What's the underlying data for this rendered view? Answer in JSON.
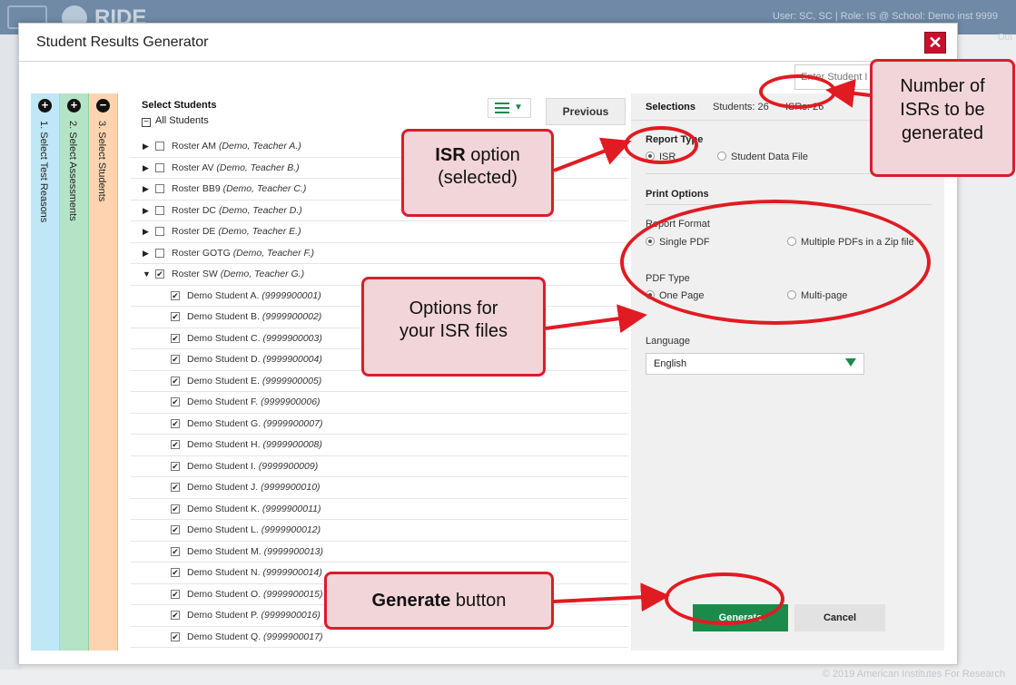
{
  "background": {
    "logo_text": "RIDE",
    "user_info": "User: SC, SC  |  Role: IS @ School: Demo inst 9999",
    "signout": "Out",
    "footer": "© 2019 American Institutes For Research"
  },
  "modal": {
    "title": "Student Results Generator",
    "close_icon": "close-icon",
    "search_placeholder": "Enter Student I"
  },
  "steps": [
    {
      "label": "1. Select Test Reasons",
      "icon": "plus"
    },
    {
      "label": "2. Select Assessments",
      "icon": "plus"
    },
    {
      "label": "3. Select Students",
      "icon": "minus"
    }
  ],
  "students_panel": {
    "title": "Select Students",
    "all_students": "All Students",
    "previous_button": "Previous",
    "rosters": [
      {
        "label": "Roster AM",
        "sub": "(Demo, Teacher A.)",
        "expanded": false,
        "checked": false
      },
      {
        "label": "Roster AV",
        "sub": "(Demo, Teacher B.)",
        "expanded": false,
        "checked": false
      },
      {
        "label": "Roster BB9",
        "sub": "(Demo, Teacher C.)",
        "expanded": false,
        "checked": false
      },
      {
        "label": "Roster DC",
        "sub": "(Demo, Teacher D.)",
        "expanded": false,
        "checked": false
      },
      {
        "label": "Roster DE",
        "sub": "(Demo, Teacher E.)",
        "expanded": false,
        "checked": false
      },
      {
        "label": "Roster GOTG",
        "sub": "(Demo, Teacher F.)",
        "expanded": false,
        "checked": false
      },
      {
        "label": "Roster SW",
        "sub": "(Demo, Teacher G.)",
        "expanded": true,
        "checked": true
      }
    ],
    "students": [
      {
        "label": "Demo Student A.",
        "sub": "(9999900001)"
      },
      {
        "label": "Demo Student B.",
        "sub": "(9999900002)"
      },
      {
        "label": "Demo Student C.",
        "sub": "(9999900003)"
      },
      {
        "label": "Demo Student D.",
        "sub": "(9999900004)"
      },
      {
        "label": "Demo Student E.",
        "sub": "(9999900005)"
      },
      {
        "label": "Demo Student F.",
        "sub": "(9999900006)"
      },
      {
        "label": "Demo Student G.",
        "sub": "(9999900007)"
      },
      {
        "label": "Demo Student H.",
        "sub": "(9999900008)"
      },
      {
        "label": "Demo Student I.",
        "sub": "(9999900009)"
      },
      {
        "label": "Demo Student J.",
        "sub": "(9999900010)"
      },
      {
        "label": "Demo Student K.",
        "sub": "(9999900011)"
      },
      {
        "label": "Demo Student L.",
        "sub": "(9999900012)"
      },
      {
        "label": "Demo Student M.",
        "sub": "(9999900013)"
      },
      {
        "label": "Demo Student N.",
        "sub": "(9999900014)"
      },
      {
        "label": "Demo Student O.",
        "sub": "(9999900015)"
      },
      {
        "label": "Demo Student P.",
        "sub": "(9999900016)"
      },
      {
        "label": "Demo Student Q.",
        "sub": "(9999900017)"
      }
    ]
  },
  "selections_panel": {
    "title": "Selections",
    "students_count": "Students: 26",
    "isrs_count": "ISRs: 26",
    "report_type_title": "Report Type",
    "report_type_options": [
      {
        "label": "ISR",
        "selected": true
      },
      {
        "label": "Student Data File",
        "selected": false
      }
    ],
    "print_options_title": "Print Options",
    "report_format_label": "Report Format",
    "report_format_options": [
      {
        "label": "Single PDF",
        "selected": true
      },
      {
        "label": "Multiple PDFs in a Zip file",
        "selected": false
      }
    ],
    "pdf_type_label": "PDF Type",
    "pdf_type_options": [
      {
        "label": "One Page",
        "selected": true
      },
      {
        "label": "Multi-page",
        "selected": false
      }
    ],
    "language_label": "Language",
    "language_value": "English",
    "generate_button": "Generate",
    "cancel_button": "Cancel"
  },
  "callouts": {
    "isr_option": {
      "bold": "ISR",
      "rest": " option",
      "line2": "(selected)"
    },
    "isrs_number": {
      "line1": "Number of",
      "line2": "ISRs to be",
      "line3": "generated"
    },
    "options_files": {
      "line1": "Options for",
      "line2": "your ISR files"
    },
    "generate": {
      "bold": "Generate",
      "rest": " button"
    }
  },
  "colors": {
    "accent_green": "#1c8a4a",
    "callout_red": "#e11b22",
    "callout_fill": "#f2d5d9",
    "close_red": "#c8102e"
  }
}
